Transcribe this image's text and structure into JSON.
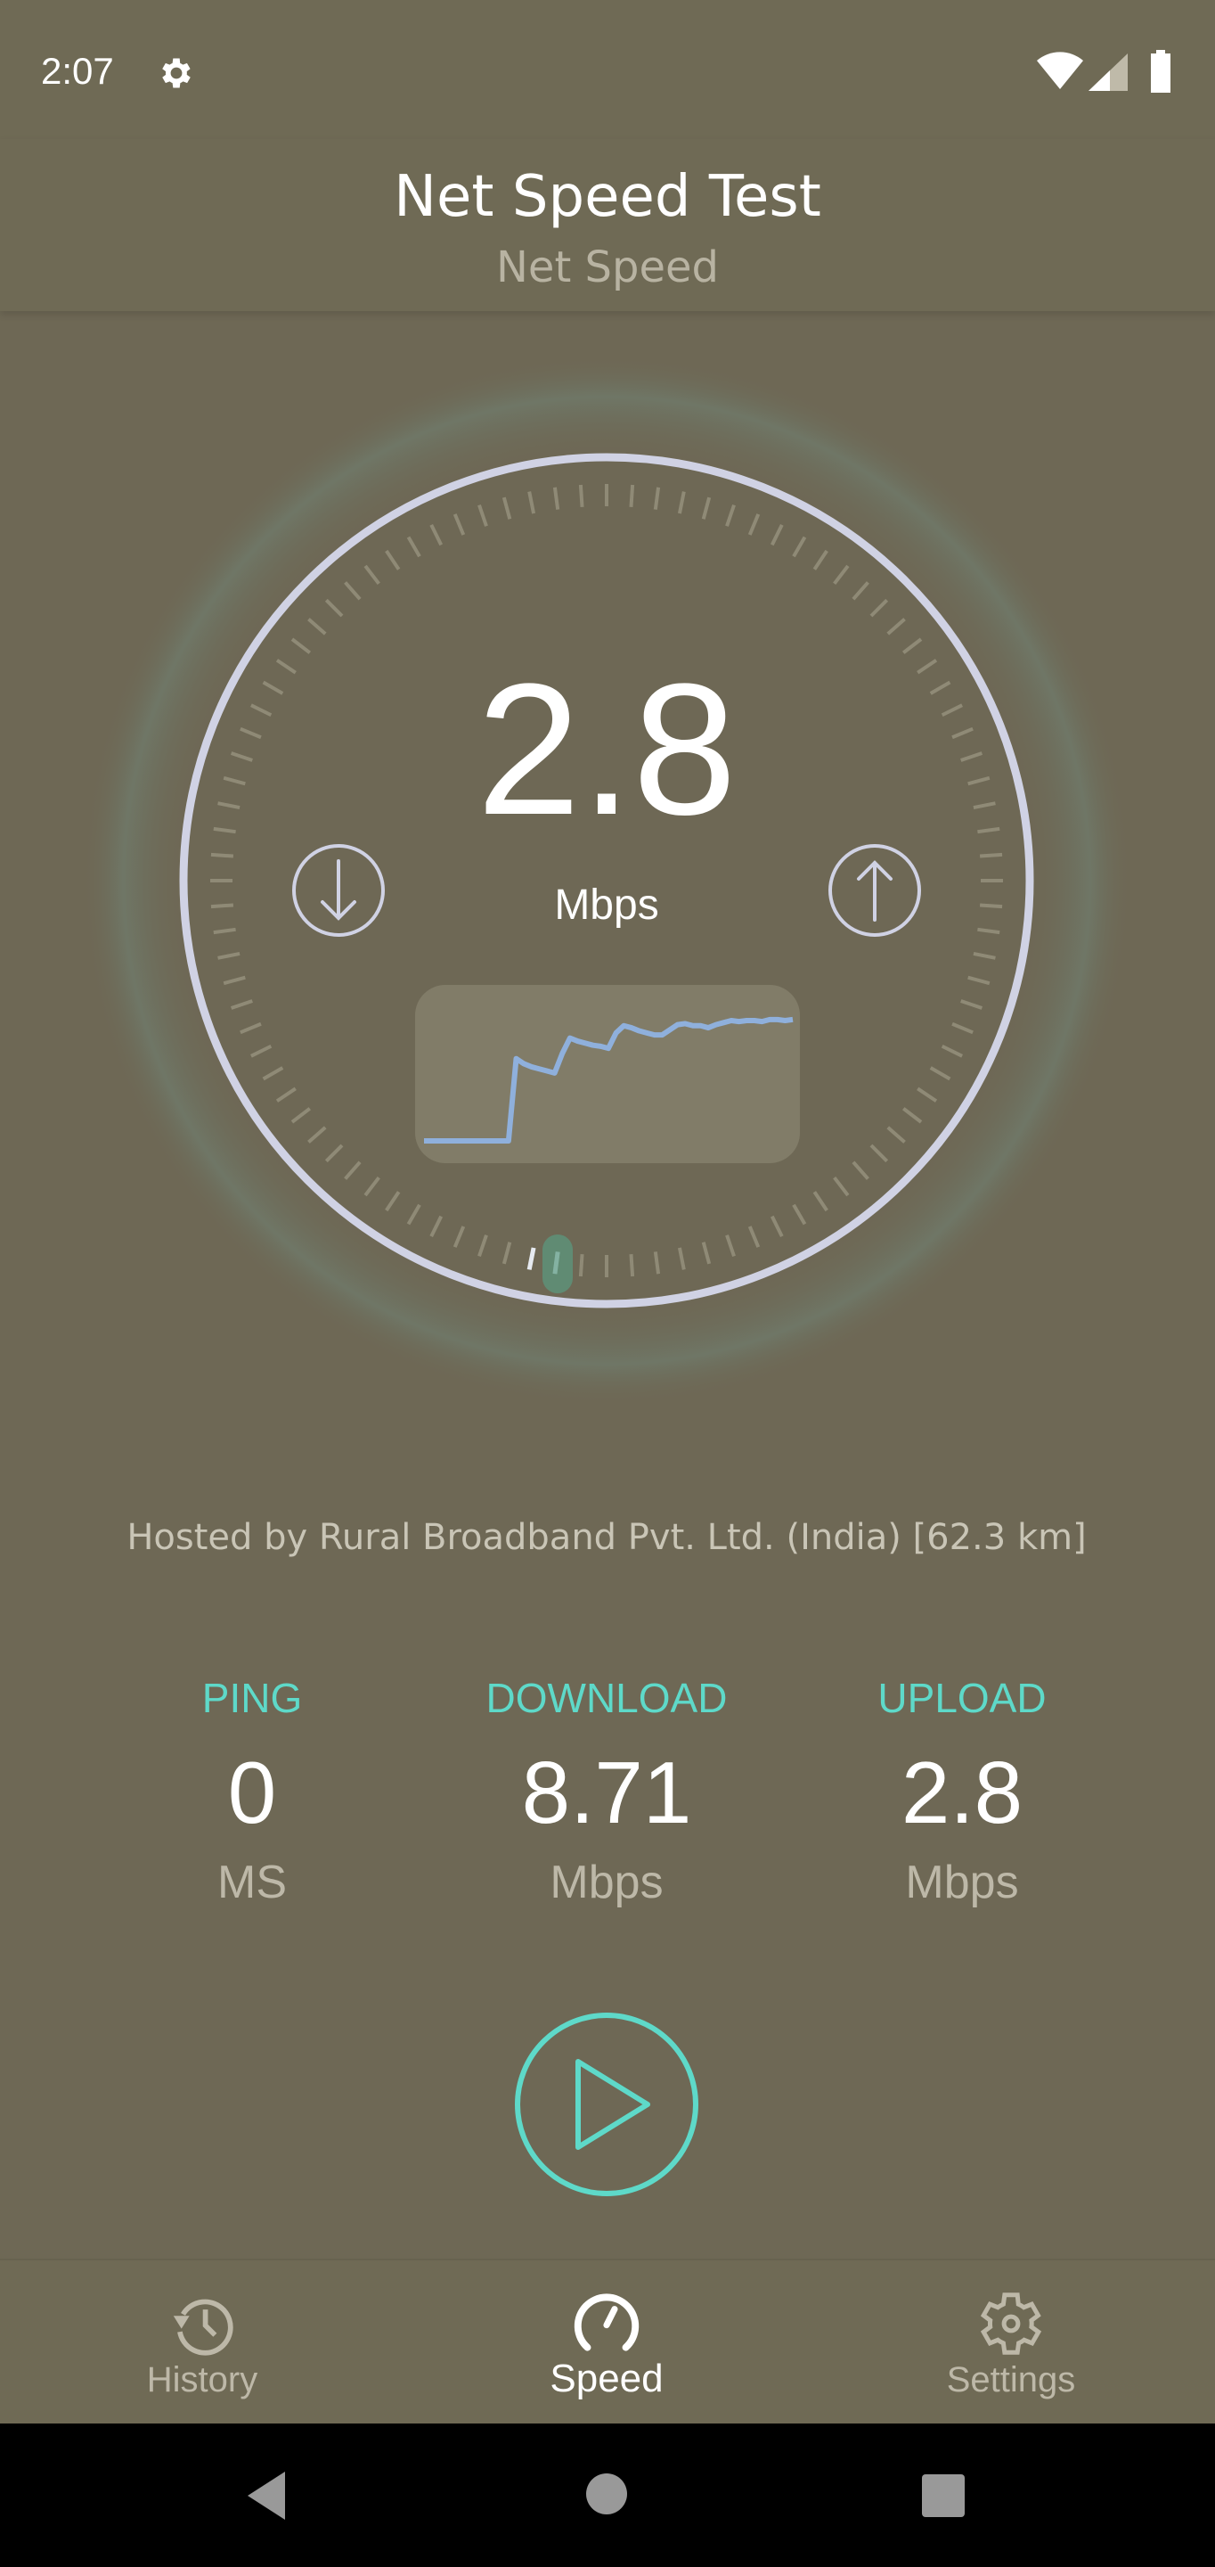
{
  "status_bar": {
    "time": "2:07",
    "icons": [
      "settings-gear-icon",
      "wifi-icon",
      "cell-signal-icon",
      "battery-icon"
    ]
  },
  "header": {
    "title": "Net Speed Test",
    "subtitle": "Net Speed"
  },
  "gauge": {
    "current_value": "2.8",
    "unit": "Mbps",
    "download_icon": "arrow-down-circle-icon",
    "upload_icon": "arrow-up-circle-icon",
    "ring_color": "#d0d2e4",
    "needle_color": "#5ed9c9"
  },
  "speed_graph": {
    "line_color": "#8fb0dc",
    "values": [
      0,
      0,
      0,
      0,
      0,
      0,
      0,
      0,
      0,
      0,
      0,
      0,
      0.8,
      0.75,
      0.72,
      0.7,
      0.68,
      0.66,
      0.85,
      1.0,
      0.97,
      0.95,
      0.93,
      0.92,
      0.9,
      1.05,
      1.12,
      1.1,
      1.07,
      1.05,
      1.03,
      1.03,
      1.08,
      1.13,
      1.14,
      1.12,
      1.12,
      1.1,
      1.13,
      1.15,
      1.17,
      1.16,
      1.17,
      1.17,
      1.16,
      1.18,
      1.18,
      1.17,
      1.18
    ]
  },
  "server": {
    "hosted_text": "Hosted by Rural Broadband Pvt. Ltd. (India) [62.3 km]"
  },
  "results": [
    {
      "label": "PING",
      "value": "0",
      "unit": "MS"
    },
    {
      "label": "DOWNLOAD",
      "value": "8.71",
      "unit": "Mbps"
    },
    {
      "label": "UPLOAD",
      "value": "2.8",
      "unit": "Mbps"
    }
  ],
  "accent": "#5ed9c9",
  "bottom_nav": [
    {
      "label": "History",
      "icon": "history-icon",
      "active": false
    },
    {
      "label": "Speed",
      "icon": "speedometer-icon",
      "active": true
    },
    {
      "label": "Settings",
      "icon": "settings-icon",
      "active": false
    }
  ],
  "system_nav": [
    "back-icon",
    "home-icon",
    "recents-icon"
  ]
}
